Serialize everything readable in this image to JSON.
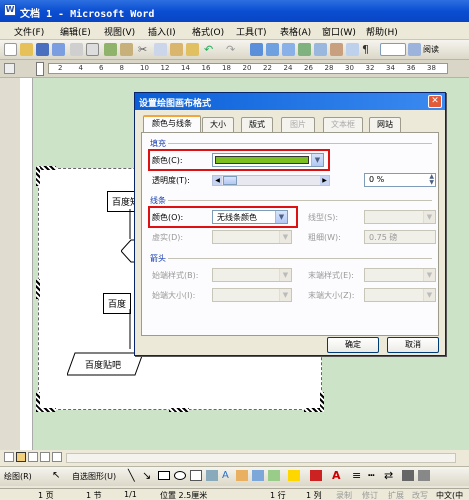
{
  "window": {
    "title": "文档 1 - Microsoft Word"
  },
  "menu": [
    "文件(F)",
    "编辑(E)",
    "视图(V)",
    "插入(I)",
    "格式(O)",
    "工具(T)",
    "表格(A)",
    "窗口(W)",
    "帮助(H)"
  ],
  "toolbar": {
    "read_label": "阅读"
  },
  "ruler": {
    "numbers": [
      "2",
      "4",
      "6",
      "8",
      "10",
      "12",
      "14",
      "16",
      "18",
      "20",
      "22",
      "24",
      "26",
      "28",
      "30",
      "32",
      "34",
      "36",
      "38"
    ]
  },
  "document": {
    "shapes": [
      "百度知",
      "百度",
      "百度",
      "百度贴吧"
    ]
  },
  "dialog": {
    "title": "设置绘图画布格式",
    "tabs": [
      "颜色与线条",
      "大小",
      "版式",
      "图片",
      "文本框",
      "网站"
    ],
    "fill": {
      "section": "填充",
      "color_label": "颜色(C):",
      "color_value": "#7cc020",
      "transparency_label": "透明度(T):",
      "transparency_value": "0 %"
    },
    "line": {
      "section": "线条",
      "color_label": "颜色(O):",
      "color_value": "无线条颜色",
      "style_label": "线型(S):",
      "dashed_label": "虚实(D):",
      "weight_label": "粗细(W):",
      "weight_value": "0.75 磅"
    },
    "arrows": {
      "section": "箭头",
      "begin_style": "始端样式(B):",
      "end_style": "末端样式(E):",
      "begin_size": "始端大小(I):",
      "end_size": "末端大小(Z):"
    },
    "ok": "确定",
    "cancel": "取消"
  },
  "drawbar": {
    "draw_label": "绘图(R)",
    "autoshape_label": "自选图形(U)"
  },
  "status": {
    "page": "1 页",
    "section": "1 节",
    "pages": "1/1",
    "position": "位置 2.5厘米",
    "line": "1 行",
    "col": "1 列",
    "rec": "录制",
    "trk": "修订",
    "ext": "扩展",
    "ovr": "改写",
    "lang": "中文(中"
  },
  "colors": {
    "fill_swatch": "#7cc020",
    "title_bar": "#0b4ed2",
    "highlight": "#d11"
  }
}
